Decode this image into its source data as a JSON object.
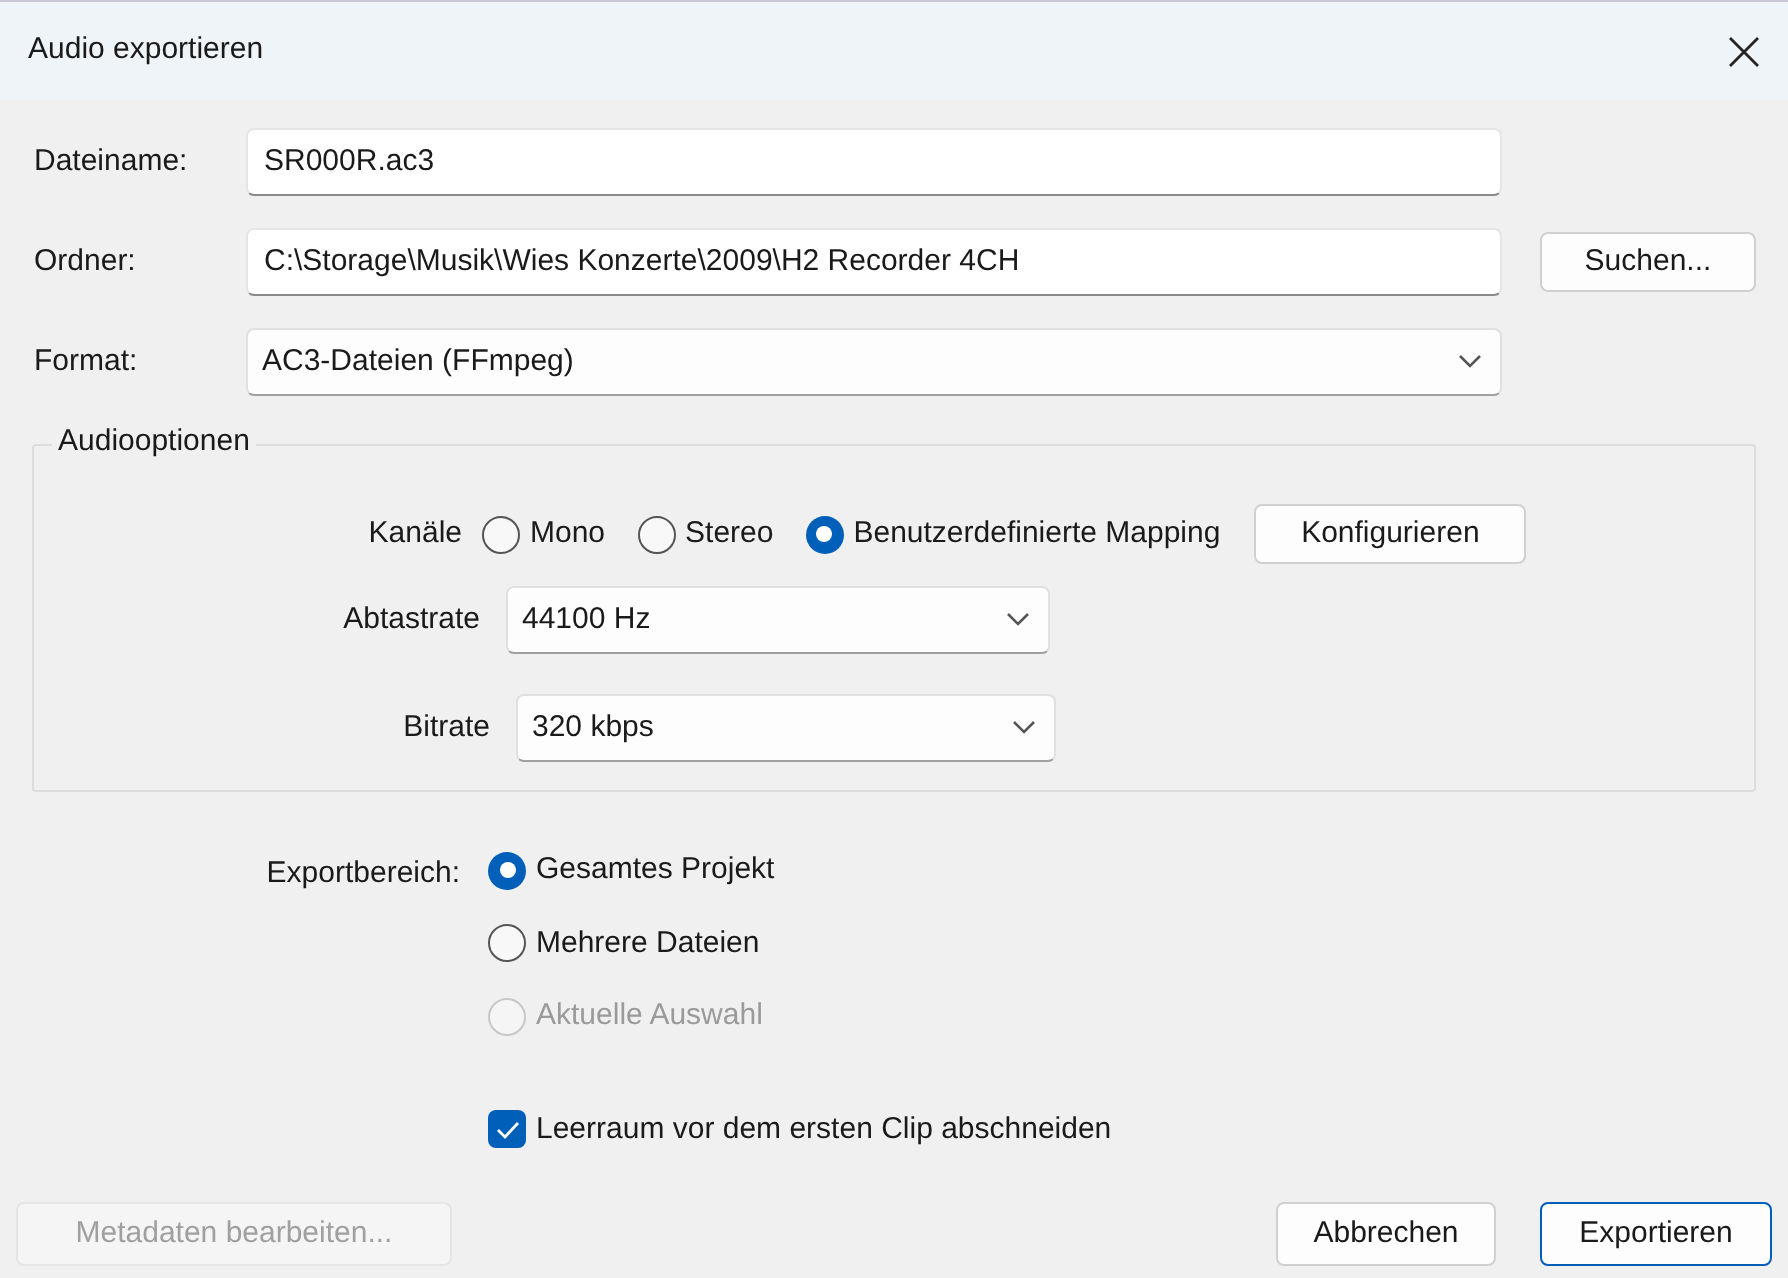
{
  "window": {
    "title": "Audio exportieren"
  },
  "fields": [
    {
      "label": "Dateiname:",
      "value": "SR000R.ac3",
      "kind": "text"
    },
    {
      "label": "Ordner:",
      "value": "C:\\Storage\\Musik\\Wies Konzerte\\2009\\H2 Recorder 4CH",
      "kind": "text",
      "button": "Suchen..."
    },
    {
      "label": "Format:",
      "value": "AC3-Dateien (FFmpeg)",
      "kind": "combo"
    }
  ],
  "audio_options": {
    "title": "Audiooptionen",
    "channels": {
      "label": "Kanäle",
      "options": [
        {
          "label": "Mono",
          "selected": false
        },
        {
          "label": "Stereo",
          "selected": false
        },
        {
          "label": "Benutzerdefinierte Mapping",
          "selected": true
        }
      ],
      "button": "Konfigurieren"
    },
    "sample_rate": {
      "label": "Abtastrate",
      "value": "44100 Hz"
    },
    "bitrate": {
      "label": "Bitrate",
      "value": "320 kbps"
    }
  },
  "export_range": {
    "label": "Exportbereich:",
    "options": [
      {
        "label": "Gesamtes Projekt",
        "selected": true,
        "disabled": false
      },
      {
        "label": "Mehrere Dateien",
        "selected": false,
        "disabled": false
      },
      {
        "label": "Aktuelle Auswahl",
        "selected": false,
        "disabled": true
      }
    ]
  },
  "trim": {
    "label": "Leerraum vor dem ersten Clip abschneiden",
    "checked": true
  },
  "buttons": [
    {
      "label": "Metadaten bearbeiten...",
      "disabled": true,
      "default": false
    },
    {
      "label": "Abbrechen",
      "disabled": false,
      "default": false
    },
    {
      "label": "Exportieren",
      "disabled": false,
      "default": true
    }
  ]
}
